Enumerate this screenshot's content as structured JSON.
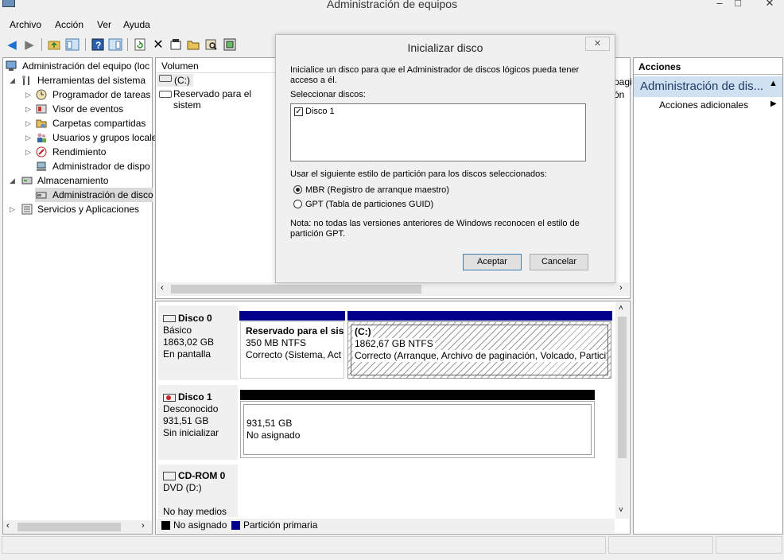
{
  "window": {
    "title": "Administración de equipos",
    "minimize": "–",
    "maximize": "□",
    "close": "✕"
  },
  "menu": [
    "Archivo",
    "Acción",
    "Ver",
    "Ayuda"
  ],
  "tree": {
    "root": "Administración del equipo (loc",
    "items": [
      {
        "label": "Herramientas del sistema",
        "icon": "tools-icon"
      },
      {
        "label": "Programador de tareas",
        "icon": "clock-icon"
      },
      {
        "label": "Visor de eventos",
        "icon": "event-viewer-icon"
      },
      {
        "label": "Carpetas compartidas",
        "icon": "shared-folder-icon"
      },
      {
        "label": "Usuarios y grupos locale",
        "icon": "users-icon"
      },
      {
        "label": "Rendimiento",
        "icon": "performance-icon"
      },
      {
        "label": "Administrador de dispo",
        "icon": "device-manager-icon"
      },
      {
        "label": "Almacenamiento",
        "icon": "storage-icon"
      },
      {
        "label": "Administración de disco",
        "icon": "disk-management-icon"
      },
      {
        "label": "Servicios y Aplicaciones",
        "icon": "services-icon"
      }
    ]
  },
  "volume_list": {
    "header": "Volumen",
    "rows": [
      "(C:)",
      "Reservado para el sistem"
    ],
    "partial_right": [
      "pagi",
      "ón"
    ]
  },
  "disks": [
    {
      "name": "Disco 0",
      "type": "Básico",
      "size": "1863,02 GB",
      "status": "En pantalla"
    },
    {
      "name": "Disco 1",
      "type": "Desconocido",
      "size": "931,51 GB",
      "status": "Sin inicializar"
    },
    {
      "name": "CD-ROM 0",
      "type": "DVD (D:)",
      "size": "",
      "status": "No hay medios"
    }
  ],
  "partitions": {
    "reserved": {
      "title": "Reservado para el sist",
      "fs": "350 MB NTFS",
      "status": "Correcto (Sistema, Act"
    },
    "c": {
      "title": "(C:)",
      "fs": "1862,67 GB NTFS",
      "status": "Correcto (Arranque, Archivo de paginación, Volcado, Partició"
    },
    "unallocated": {
      "size": "931,51 GB",
      "status": "No asignado"
    }
  },
  "legend": [
    {
      "label": "No asignado",
      "color": "#000000"
    },
    {
      "label": "Partición primaria",
      "color": "#00008b"
    }
  ],
  "dialog": {
    "title": "Inicializar disco",
    "intro": [
      "Inicialice un disco para que el Administrador de discos lógicos pueda tener",
      "acceso a él."
    ],
    "select_label": "Seleccionar discos:",
    "disk_item": "Disco 1",
    "style_label": "Usar el siguiente estilo de partición para los discos seleccionados:",
    "mbr": "MBR (Registro de arranque maestro)",
    "gpt": "GPT (Tabla de particiones GUID)",
    "note": [
      "Nota: no todas las versiones anteriores de Windows reconocen el estilo de",
      "partición GPT."
    ],
    "ok": "Aceptar",
    "cancel": "Cancelar",
    "close": "✕"
  },
  "actions": {
    "header": "Acciones",
    "section": "Administración de dis...",
    "more": "Acciones adicionales"
  }
}
